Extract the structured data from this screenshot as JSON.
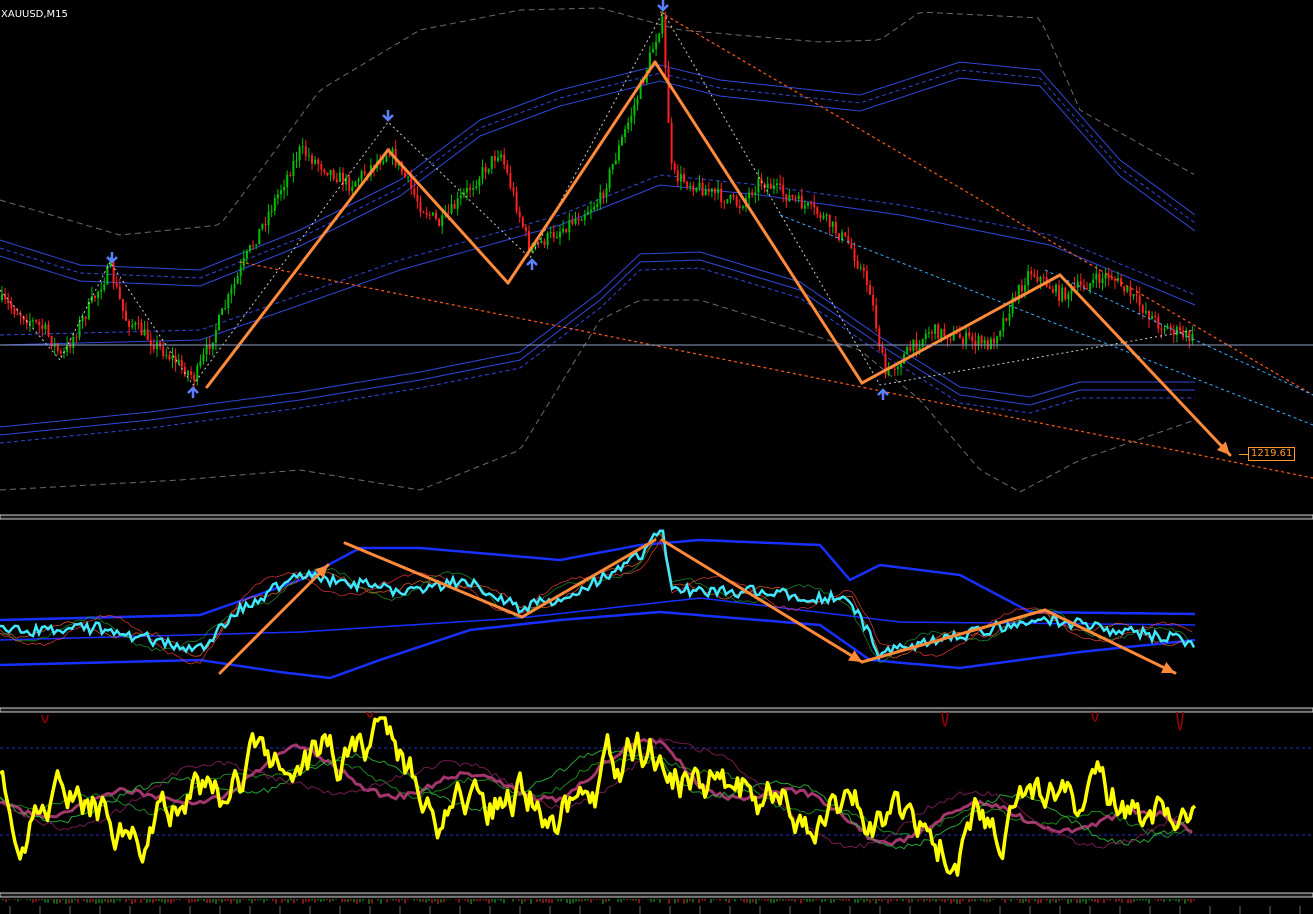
{
  "window": {
    "symbol_label": "XAUUSD,M15"
  },
  "price_tag": {
    "value": "1219.61"
  },
  "colors": {
    "background": "#000000",
    "bull_candle": "#00c000",
    "bear_candle": "#ff2020",
    "zigzag_arrow": "#ff8a3a",
    "bands_blue": "#3a55ff",
    "trendline_red": "#ff5a1a",
    "oscillator_cyan": "#40e8ff",
    "oscillator_yellow": "#ffff00",
    "separator": "#cfcfcf"
  },
  "chart_data": [
    {
      "type": "candlestick",
      "panel": "main",
      "symbol": "XAUUSD",
      "timeframe": "M15",
      "zigzag_turning_points": [
        {
          "label": "low",
          "price": 1228.5
        },
        {
          "label": "high",
          "price": 1236.2
        },
        {
          "label": "low",
          "price": 1232.4
        },
        {
          "label": "high",
          "price": 1241.6
        },
        {
          "label": "low",
          "price": 1225.7
        },
        {
          "label": "high",
          "price": 1229.9
        },
        {
          "label": "projection",
          "price": 1219.61
        }
      ],
      "annotations": [
        "1219.61"
      ]
    },
    {
      "type": "line",
      "panel": "oscillator-1",
      "series_colors": [
        "#40e8ff",
        "#ff8040",
        "#2030ff"
      ]
    },
    {
      "type": "line",
      "panel": "oscillator-2",
      "series_colors": [
        "#ffff00",
        "#c04080",
        "#20a020"
      ]
    }
  ]
}
